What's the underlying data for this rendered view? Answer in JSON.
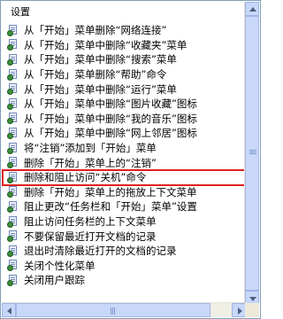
{
  "header": {
    "title": "设置"
  },
  "selected_index": 12,
  "colors": {
    "selection_outline": "#e02020"
  },
  "items": [
    {
      "label": "从「开始」菜单删除“网络连接”"
    },
    {
      "label": "从「开始」菜单中删除“收藏夹”菜单"
    },
    {
      "label": "从「开始」菜单中删除“搜索”菜单"
    },
    {
      "label": "从「开始」菜单删除“帮助”命令"
    },
    {
      "label": "从「开始」菜单中删除“运行”菜单"
    },
    {
      "label": "从「开始」菜单中删除“图片收藏”图标"
    },
    {
      "label": "从「开始」菜单中删除“我的音乐”图标"
    },
    {
      "label": "从「开始」菜单中删除“网上邻居”图标"
    },
    {
      "label": "将“注销”添加到「开始」菜单"
    },
    {
      "label": "删除「开始」菜单上的“注销”"
    },
    {
      "label": "删除和阻止访问“关机”命令"
    },
    {
      "label": "删除「开始」菜单上的拖放上下文菜单"
    },
    {
      "label": "阻止更改“任务栏和「开始」菜单”设置"
    },
    {
      "label": "阻止访问任务栏的上下文菜单"
    },
    {
      "label": "不要保留最近打开文档的记录"
    },
    {
      "label": "退出时清除最近打开的文档的记录"
    },
    {
      "label": "关闭个性化菜单"
    },
    {
      "label": "关闭用户跟踪"
    }
  ]
}
